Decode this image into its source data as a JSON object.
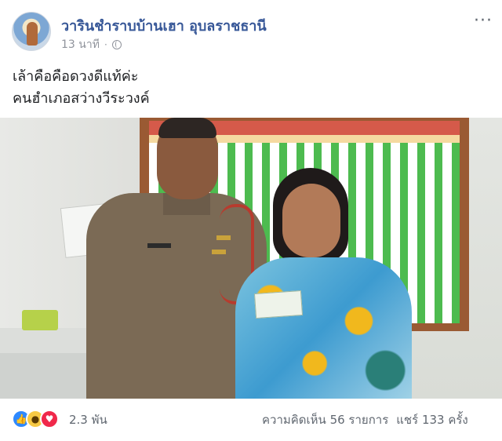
{
  "header": {
    "page_name": "วารินชำราบบ้านเฮา อุบลราชธานี",
    "time": "13 นาที",
    "separator": "·",
    "more": "···"
  },
  "post": {
    "line1": "เล้าคือคือดวงดีแท้ค่ะ",
    "line2": "คนฮำเภอสว่างวีระวงค์"
  },
  "footer": {
    "reaction_count": "2.3 พัน",
    "comments": "ความคิดเห็น 56 รายการ",
    "shares": "แชร์ 133 ครั้ง"
  },
  "icons": {
    "like": "like-icon",
    "wow": "wow-icon",
    "love": "love-icon",
    "privacy": "globe-icon"
  },
  "colors": {
    "link": "#385898",
    "like": "#2e89ff",
    "love": "#f0284a",
    "wow": "#f7c944"
  }
}
